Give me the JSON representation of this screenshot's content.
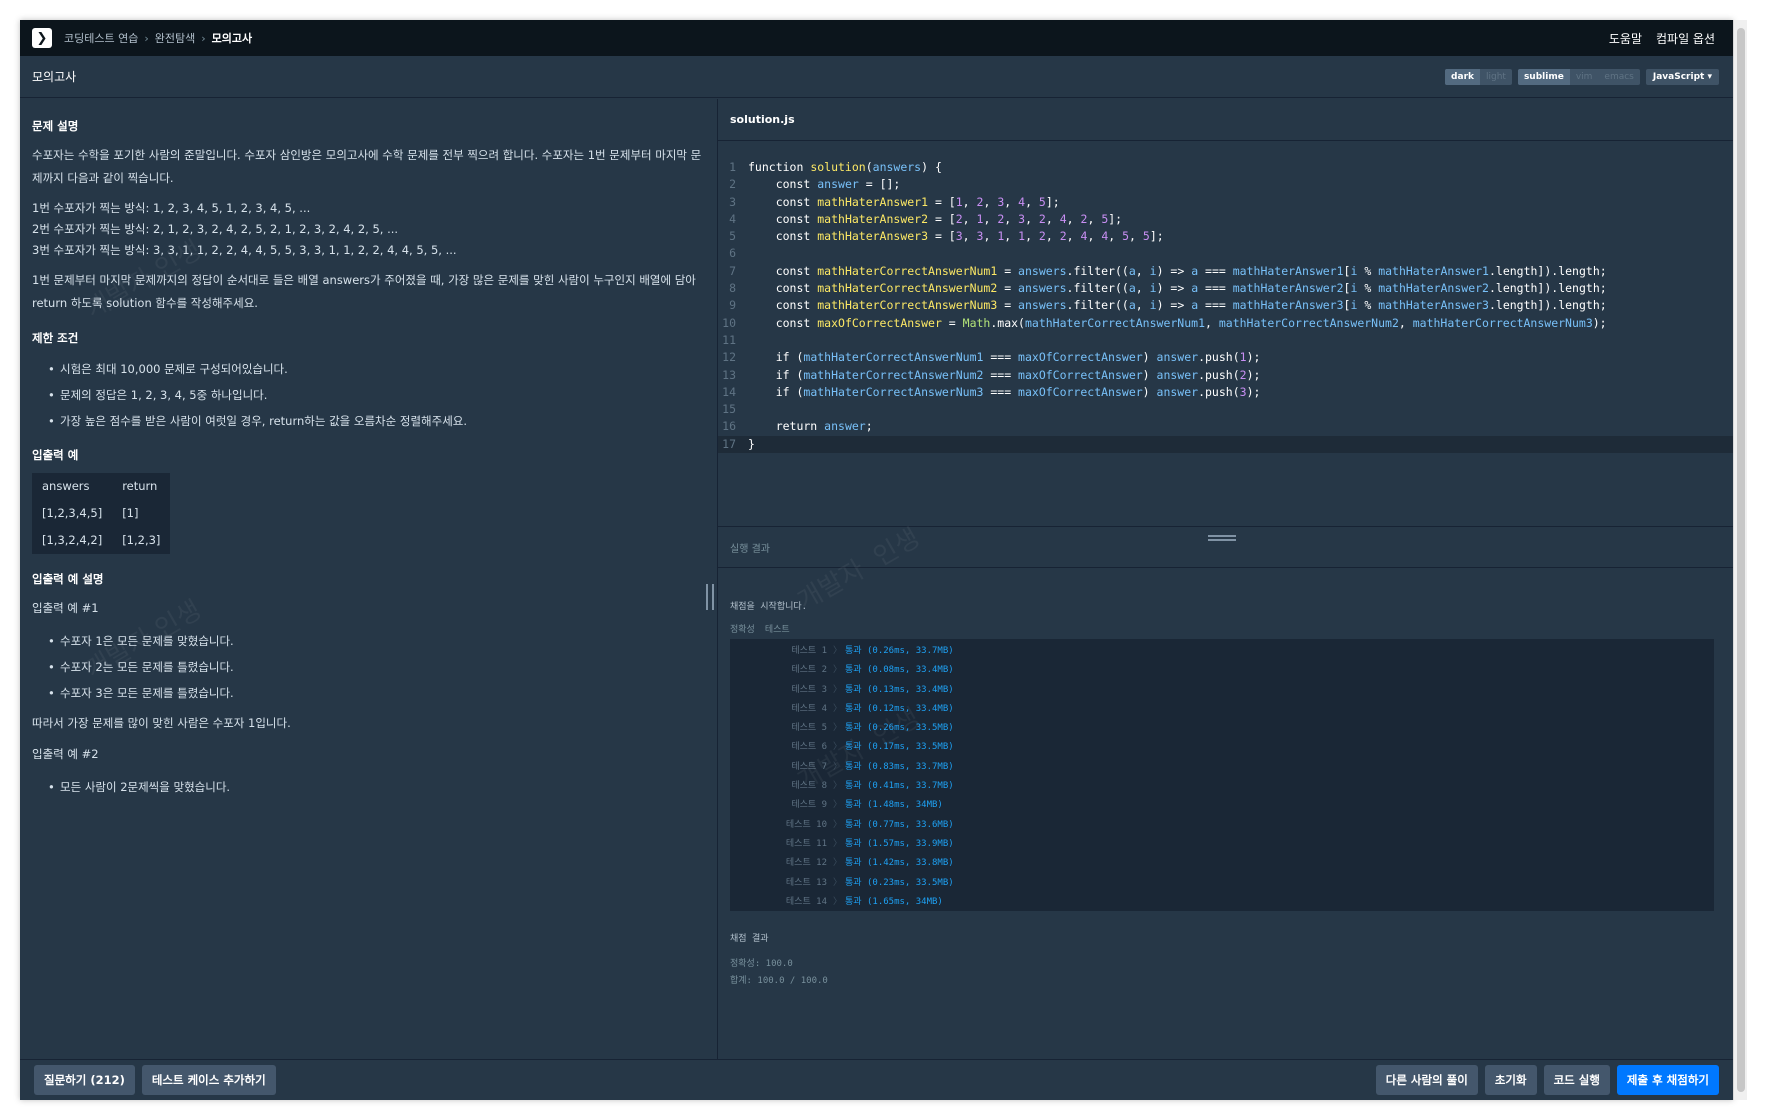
{
  "nav": {
    "breadcrumbs": [
      "코딩테스트 연습",
      "완전탐색",
      "모의고사"
    ],
    "help": "도움말",
    "compile_options": "컴파일 옵션"
  },
  "titlebar": {
    "title": "모의고사",
    "themes": [
      "dark",
      "light"
    ],
    "keymaps": [
      "sublime",
      "vim",
      "emacs"
    ],
    "language": "JavaScript"
  },
  "problem": {
    "heading_desc": "문제 설명",
    "desc": "수포자는 수학을 포기한 사람의 준말입니다. 수포자 삼인방은 모의고사에 수학 문제를 전부 찍으려 합니다. 수포자는 1번 문제부터 마지막 문제까지 다음과 같이 찍습니다.",
    "methods": [
      "1번 수포자가 찍는 방식: 1, 2, 3, 4, 5, 1, 2, 3, 4, 5, ...",
      "2번 수포자가 찍는 방식: 2, 1, 2, 3, 2, 4, 2, 5, 2, 1, 2, 3, 2, 4, 2, 5, ...",
      "3번 수포자가 찍는 방식: 3, 3, 1, 1, 2, 2, 4, 4, 5, 5, 3, 3, 1, 1, 2, 2, 4, 4, 5, 5, ..."
    ],
    "task": "1번 문제부터 마지막 문제까지의 정답이 순서대로 들은 배열 answers가 주어졌을 때, 가장 많은 문제를 맞힌 사람이 누구인지 배열에 담아 return 하도록 solution 함수를 작성해주세요.",
    "heading_limits": "제한 조건",
    "limits": [
      "시험은 최대 10,000 문제로 구성되어있습니다.",
      "문제의 정답은 1, 2, 3, 4, 5중 하나입니다.",
      "가장 높은 점수를 받은 사람이 여럿일 경우, return하는 값을 오름차순 정렬해주세요."
    ],
    "heading_io": "입출력 예",
    "io_headers": [
      "answers",
      "return"
    ],
    "io_rows": [
      [
        "[1,2,3,4,5]",
        "[1]"
      ],
      [
        "[1,3,2,4,2]",
        "[1,2,3]"
      ]
    ],
    "heading_io_desc": "입출력 예 설명",
    "ex1_title": "입출력 예 #1",
    "ex1_items": [
      "수포자 1은 모든 문제를 맞혔습니다.",
      "수포자 2는 모든 문제를 틀렸습니다.",
      "수포자 3은 모든 문제를 틀렸습니다."
    ],
    "ex1_conclusion": "따라서 가장 문제를 많이 맞힌 사람은 수포자 1입니다.",
    "ex2_title": "입출력 예 #2",
    "ex2_items": [
      "모든 사람이 2문제씩을 맞혔습니다."
    ]
  },
  "editor": {
    "filename": "solution.js",
    "current_line": 17,
    "lines": [
      [
        [
          "kw",
          "function "
        ],
        [
          "fn",
          "solution"
        ],
        [
          "p",
          "("
        ],
        [
          "var",
          "answers"
        ],
        [
          "p",
          ") {"
        ]
      ],
      [
        [
          "kw",
          "    const "
        ],
        [
          "var",
          "answer"
        ],
        [
          "p",
          " = [];"
        ]
      ],
      [
        [
          "kw",
          "    const "
        ],
        [
          "fn",
          "mathHaterAnswer1"
        ],
        [
          "p",
          " = ["
        ],
        [
          "num",
          "1"
        ],
        [
          "p",
          ", "
        ],
        [
          "num",
          "2"
        ],
        [
          "p",
          ", "
        ],
        [
          "num",
          "3"
        ],
        [
          "p",
          ", "
        ],
        [
          "num",
          "4"
        ],
        [
          "p",
          ", "
        ],
        [
          "num",
          "5"
        ],
        [
          "p",
          "];"
        ]
      ],
      [
        [
          "kw",
          "    const "
        ],
        [
          "fn",
          "mathHaterAnswer2"
        ],
        [
          "p",
          " = ["
        ],
        [
          "num",
          "2"
        ],
        [
          "p",
          ", "
        ],
        [
          "num",
          "1"
        ],
        [
          "p",
          ", "
        ],
        [
          "num",
          "2"
        ],
        [
          "p",
          ", "
        ],
        [
          "num",
          "3"
        ],
        [
          "p",
          ", "
        ],
        [
          "num",
          "2"
        ],
        [
          "p",
          ", "
        ],
        [
          "num",
          "4"
        ],
        [
          "p",
          ", "
        ],
        [
          "num",
          "2"
        ],
        [
          "p",
          ", "
        ],
        [
          "num",
          "5"
        ],
        [
          "p",
          "];"
        ]
      ],
      [
        [
          "kw",
          "    const "
        ],
        [
          "fn",
          "mathHaterAnswer3"
        ],
        [
          "p",
          " = ["
        ],
        [
          "num",
          "3"
        ],
        [
          "p",
          ", "
        ],
        [
          "num",
          "3"
        ],
        [
          "p",
          ", "
        ],
        [
          "num",
          "1"
        ],
        [
          "p",
          ", "
        ],
        [
          "num",
          "1"
        ],
        [
          "p",
          ", "
        ],
        [
          "num",
          "2"
        ],
        [
          "p",
          ", "
        ],
        [
          "num",
          "2"
        ],
        [
          "p",
          ", "
        ],
        [
          "num",
          "4"
        ],
        [
          "p",
          ", "
        ],
        [
          "num",
          "4"
        ],
        [
          "p",
          ", "
        ],
        [
          "num",
          "5"
        ],
        [
          "p",
          ", "
        ],
        [
          "num",
          "5"
        ],
        [
          "p",
          "];"
        ]
      ],
      [],
      [
        [
          "kw",
          "    const "
        ],
        [
          "fn",
          "mathHaterCorrectAnswerNum1"
        ],
        [
          "p",
          " = "
        ],
        [
          "var",
          "answers"
        ],
        [
          "p",
          ".filter(("
        ],
        [
          "var",
          "a"
        ],
        [
          "p",
          ", "
        ],
        [
          "var",
          "i"
        ],
        [
          "p",
          ") => "
        ],
        [
          "var",
          "a"
        ],
        [
          "p",
          " === "
        ],
        [
          "var",
          "mathHaterAnswer1"
        ],
        [
          "p",
          "["
        ],
        [
          "var",
          "i"
        ],
        [
          "p",
          " % "
        ],
        [
          "var",
          "mathHaterAnswer1"
        ],
        [
          "p",
          ".length]).length;"
        ]
      ],
      [
        [
          "kw",
          "    const "
        ],
        [
          "fn",
          "mathHaterCorrectAnswerNum2"
        ],
        [
          "p",
          " = "
        ],
        [
          "var",
          "answers"
        ],
        [
          "p",
          ".filter(("
        ],
        [
          "var",
          "a"
        ],
        [
          "p",
          ", "
        ],
        [
          "var",
          "i"
        ],
        [
          "p",
          ") => "
        ],
        [
          "var",
          "a"
        ],
        [
          "p",
          " === "
        ],
        [
          "var",
          "mathHaterAnswer2"
        ],
        [
          "p",
          "["
        ],
        [
          "var",
          "i"
        ],
        [
          "p",
          " % "
        ],
        [
          "var",
          "mathHaterAnswer2"
        ],
        [
          "p",
          ".length]).length;"
        ]
      ],
      [
        [
          "kw",
          "    const "
        ],
        [
          "fn",
          "mathHaterCorrectAnswerNum3"
        ],
        [
          "p",
          " = "
        ],
        [
          "var",
          "answers"
        ],
        [
          "p",
          ".filter(("
        ],
        [
          "var",
          "a"
        ],
        [
          "p",
          ", "
        ],
        [
          "var",
          "i"
        ],
        [
          "p",
          ") => "
        ],
        [
          "var",
          "a"
        ],
        [
          "p",
          " === "
        ],
        [
          "var",
          "mathHaterAnswer3"
        ],
        [
          "p",
          "["
        ],
        [
          "var",
          "i"
        ],
        [
          "p",
          " % "
        ],
        [
          "var",
          "mathHaterAnswer3"
        ],
        [
          "p",
          ".length]).length;"
        ]
      ],
      [
        [
          "kw",
          "    const "
        ],
        [
          "fn",
          "maxOfCorrectAnswer"
        ],
        [
          "p",
          " = "
        ],
        [
          "obj",
          "Math"
        ],
        [
          "p",
          ".max("
        ],
        [
          "var",
          "mathHaterCorrectAnswerNum1"
        ],
        [
          "p",
          ", "
        ],
        [
          "var",
          "mathHaterCorrectAnswerNum2"
        ],
        [
          "p",
          ", "
        ],
        [
          "var",
          "mathHaterCorrectAnswerNum3"
        ],
        [
          "p",
          ");"
        ]
      ],
      [],
      [
        [
          "kw",
          "    if "
        ],
        [
          "p",
          "("
        ],
        [
          "var",
          "mathHaterCorrectAnswerNum1"
        ],
        [
          "p",
          " === "
        ],
        [
          "var",
          "maxOfCorrectAnswer"
        ],
        [
          "p",
          ") "
        ],
        [
          "var",
          "answer"
        ],
        [
          "p",
          ".push("
        ],
        [
          "num",
          "1"
        ],
        [
          "p",
          ");"
        ]
      ],
      [
        [
          "kw",
          "    if "
        ],
        [
          "p",
          "("
        ],
        [
          "var",
          "mathHaterCorrectAnswerNum2"
        ],
        [
          "p",
          " === "
        ],
        [
          "var",
          "maxOfCorrectAnswer"
        ],
        [
          "p",
          ") "
        ],
        [
          "var",
          "answer"
        ],
        [
          "p",
          ".push("
        ],
        [
          "num",
          "2"
        ],
        [
          "p",
          ");"
        ]
      ],
      [
        [
          "kw",
          "    if "
        ],
        [
          "p",
          "("
        ],
        [
          "var",
          "mathHaterCorrectAnswerNum3"
        ],
        [
          "p",
          " === "
        ],
        [
          "var",
          "maxOfCorrectAnswer"
        ],
        [
          "p",
          ") "
        ],
        [
          "var",
          "answer"
        ],
        [
          "p",
          ".push("
        ],
        [
          "num",
          "3"
        ],
        [
          "p",
          ");"
        ]
      ],
      [],
      [
        [
          "kw",
          "    return "
        ],
        [
          "var",
          "answer"
        ],
        [
          "p",
          ";"
        ]
      ],
      [
        [
          "p",
          "}"
        ]
      ]
    ]
  },
  "results": {
    "heading": "실행 결과",
    "start_msg": "채점을 시작합니다.",
    "tabs": [
      "정확성",
      "테스트"
    ],
    "tests": [
      {
        "name": "테스트 1",
        "result": "통과 (0.26ms, 33.7MB)"
      },
      {
        "name": "테스트 2",
        "result": "통과 (0.08ms, 33.4MB)"
      },
      {
        "name": "테스트 3",
        "result": "통과 (0.13ms, 33.4MB)"
      },
      {
        "name": "테스트 4",
        "result": "통과 (0.12ms, 33.4MB)"
      },
      {
        "name": "테스트 5",
        "result": "통과 (0.26ms, 33.5MB)"
      },
      {
        "name": "테스트 6",
        "result": "통과 (0.17ms, 33.5MB)"
      },
      {
        "name": "테스트 7",
        "result": "통과 (0.83ms, 33.7MB)"
      },
      {
        "name": "테스트 8",
        "result": "통과 (0.41ms, 33.7MB)"
      },
      {
        "name": "테스트 9",
        "result": "통과 (1.48ms, 34MB)"
      },
      {
        "name": "테스트 10",
        "result": "통과 (0.77ms, 33.6MB)"
      },
      {
        "name": "테스트 11",
        "result": "통과 (1.57ms, 33.9MB)"
      },
      {
        "name": "테스트 12",
        "result": "통과 (1.42ms, 33.8MB)"
      },
      {
        "name": "테스트 13",
        "result": "통과 (0.23ms, 33.5MB)"
      },
      {
        "name": "테스트 14",
        "result": "통과 (1.65ms, 34MB)"
      }
    ],
    "summary_heading": "채점 결과",
    "accuracy": "정확성: 100.0",
    "total": "합계: 100.0 / 100.0"
  },
  "bottom": {
    "ask": "질문하기 (212)",
    "add_testcase": "테스트 케이스 추가하기",
    "others": "다른 사람의 풀이",
    "reset": "초기화",
    "run": "코드 실행",
    "submit": "제출 후 채점하기"
  },
  "watermark": "개발자 인생"
}
